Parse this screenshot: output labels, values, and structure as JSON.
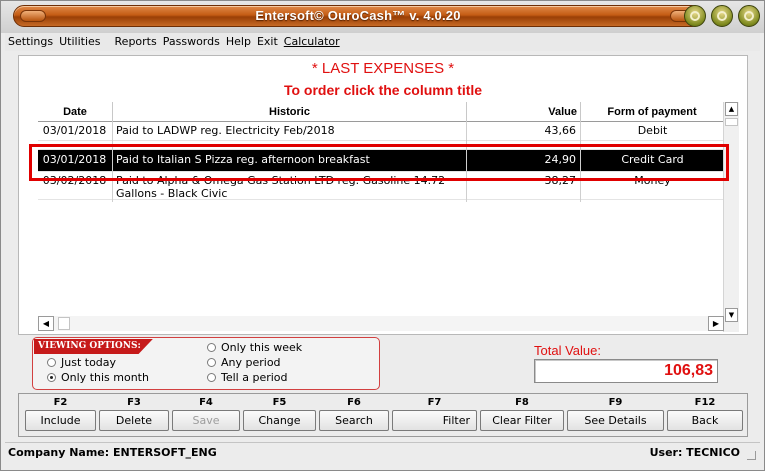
{
  "window": {
    "title": "Entersoft© OuroCash™ v. 4.0.20"
  },
  "menu": {
    "items": [
      "Settings",
      "Utilities",
      "Reports",
      "Passwords",
      "Help",
      "Exit",
      "Calculator"
    ]
  },
  "main": {
    "heading": "* LAST EXPENSES *",
    "subheading": "To order click the column title",
    "columns": [
      "Date",
      "Historic",
      "Value",
      "Form of payment"
    ],
    "rows": [
      {
        "date": "03/01/2018",
        "historic": "Paid to LADWP reg. Electricity Feb/2018",
        "value": "43,66",
        "payment": "Debit"
      },
      {
        "date": "03/01/2018",
        "historic": "Paid to Italian S Pizza reg. afternoon breakfast",
        "value": "24,90",
        "payment": "Credit Card"
      },
      {
        "date": "03/02/2018",
        "historic": "Paid to Alpha & Omega Gas Station LTD reg. Gasoline 14.72 Gallons - Black Civic",
        "value": "38,27",
        "payment": "Money"
      }
    ],
    "selected_row": 1
  },
  "viewing": {
    "label": "VIEWING OPTIONS:",
    "options": [
      {
        "label": "Just today",
        "selected": false
      },
      {
        "label": "Only this month",
        "selected": true
      },
      {
        "label": "Only this week",
        "selected": false
      },
      {
        "label": "Any period",
        "selected": false
      },
      {
        "label": "Tell a period",
        "selected": false
      }
    ]
  },
  "total": {
    "label": "Total Value:",
    "value": "106,83"
  },
  "fkeys": [
    {
      "key": "F2",
      "label": "Include",
      "enabled": true
    },
    {
      "key": "F3",
      "label": "Delete",
      "enabled": true
    },
    {
      "key": "F4",
      "label": "Save",
      "enabled": false
    },
    {
      "key": "F5",
      "label": "Change",
      "enabled": true
    },
    {
      "key": "F6",
      "label": "Search",
      "enabled": true
    },
    {
      "key": "F7",
      "label": "Filter",
      "enabled": true
    },
    {
      "key": "F8",
      "label": "Clear Filter",
      "enabled": true
    },
    {
      "key": "F9",
      "label": "See Details",
      "enabled": true
    },
    {
      "key": "F12",
      "label": "Back",
      "enabled": true
    }
  ],
  "status": {
    "company": "Company Name: ENTERSOFT_ENG",
    "user": "User: TECNICO"
  },
  "colors": {
    "accent_red": "#e01010",
    "title_orange": "#c45c14",
    "window_button": "#7e8a1e"
  }
}
